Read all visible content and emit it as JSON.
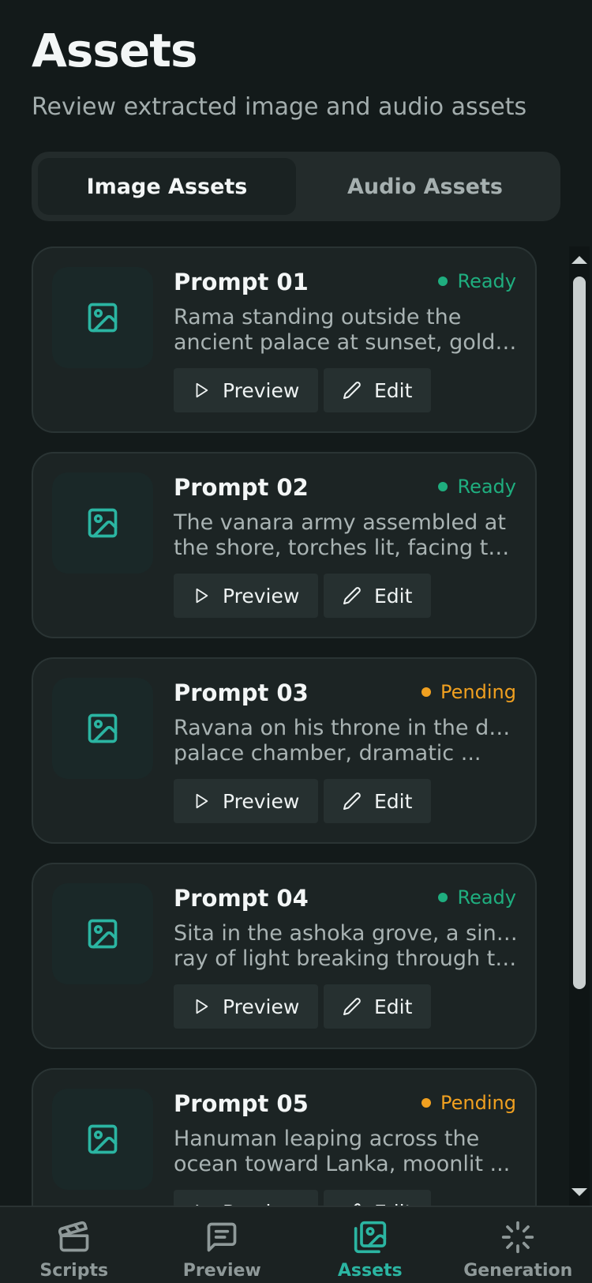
{
  "header": {
    "title": "Assets",
    "subtitle": "Review extracted image and audio assets"
  },
  "tabs": [
    {
      "label": "Image Assets",
      "active": true
    },
    {
      "label": "Audio Assets",
      "active": false
    }
  ],
  "colors": {
    "accent": "#2bb5a2",
    "ready": "#1fae7f",
    "pending": "#f0a020"
  },
  "buttons": {
    "preview_label": "Preview",
    "edit_label": "Edit"
  },
  "assets": [
    {
      "title": "Prompt 01",
      "status": "Ready",
      "desc_line1": "Rama standing outside the",
      "desc_line2": "ancient palace at sunset, golde..."
    },
    {
      "title": "Prompt 02",
      "status": "Ready",
      "desc_line1": "The vanara army assembled at",
      "desc_line2": "the shore, torches lit, facing the..."
    },
    {
      "title": "Prompt 03",
      "status": "Pending",
      "desc_line1": "Ravana on his throne in the dark",
      "desc_line2": "palace chamber, dramatic ..."
    },
    {
      "title": "Prompt 04",
      "status": "Ready",
      "desc_line1": "Sita in the ashoka grove, a single",
      "desc_line2": "ray of light breaking through th..."
    },
    {
      "title": "Prompt 05",
      "status": "Pending",
      "desc_line1": "Hanuman leaping across the",
      "desc_line2": "ocean toward Lanka, moonlit ..."
    }
  ],
  "nav": [
    {
      "label": "Scripts",
      "icon": "clapperboard-icon",
      "active": false
    },
    {
      "label": "Preview",
      "icon": "message-text-icon",
      "active": false
    },
    {
      "label": "Assets",
      "icon": "images-icon",
      "active": true
    },
    {
      "label": "Generation",
      "icon": "loader-icon",
      "active": false
    }
  ]
}
